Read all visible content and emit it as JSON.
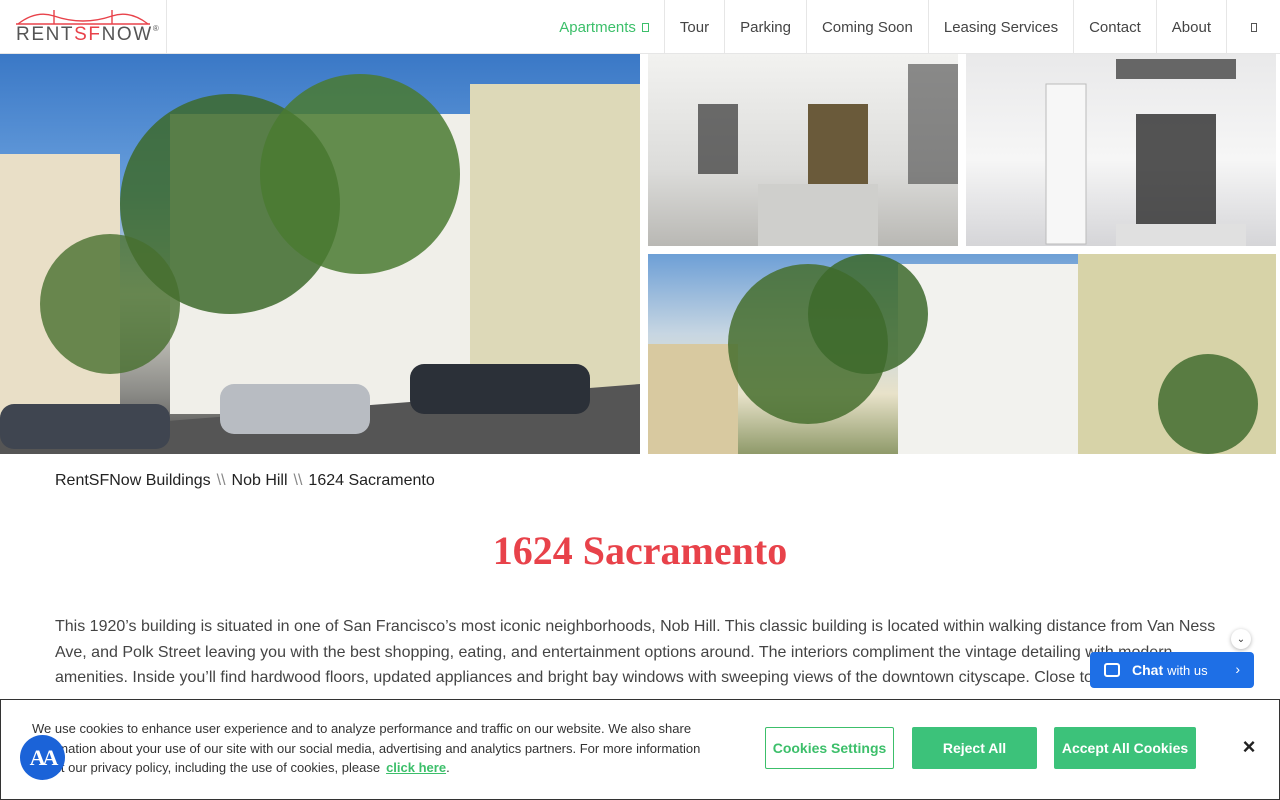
{
  "header": {
    "logo": {
      "part1": "RENT",
      "part2": "SF",
      "part3": "NOW",
      "reg": "®"
    },
    "nav": [
      {
        "label": "Apartments"
      },
      {
        "label": "Tour"
      },
      {
        "label": "Parking"
      },
      {
        "label": "Coming Soon"
      },
      {
        "label": "Leasing Services"
      },
      {
        "label": "Contact"
      },
      {
        "label": "About"
      }
    ]
  },
  "breadcrumb": {
    "items": [
      "RentSFNow Buildings",
      "Nob Hill",
      "1624 Sacramento"
    ],
    "separator": "\\\\"
  },
  "page": {
    "title": "1624 Sacramento",
    "description": "This 1920’s building is situated in one of San Francisco’s most iconic neighborhoods, Nob Hill. This classic building is located within walking distance from Van Ness Ave, and Polk Street leaving you with the best shopping, eating, and entertainment options around. The interiors compliment the vintage detailing with modern amenities. Inside you’ll find hardwood floors, updated appliances and bright bay windows with sweeping views of the downtown cityscape. Close to"
  },
  "chat": {
    "bold": "Chat",
    "small": "with us"
  },
  "cookie": {
    "text": "We use cookies to enhance user experience and to analyze performance and traffic on our website. We also share information about your use of our site with our social media, advertising and analytics partners. For more information about our privacy policy, including the use of cookies, please",
    "link": "click here",
    "after_link": ".",
    "settings_label": "Cookies Settings",
    "reject_label": "Reject All",
    "accept_label": "Accept All Cookies",
    "close_label": "×"
  },
  "accessibility_badge": "AA",
  "colors": {
    "accent_green": "#3cbf6a",
    "title_red": "#e8424a",
    "chat_blue": "#1e6fe6"
  }
}
